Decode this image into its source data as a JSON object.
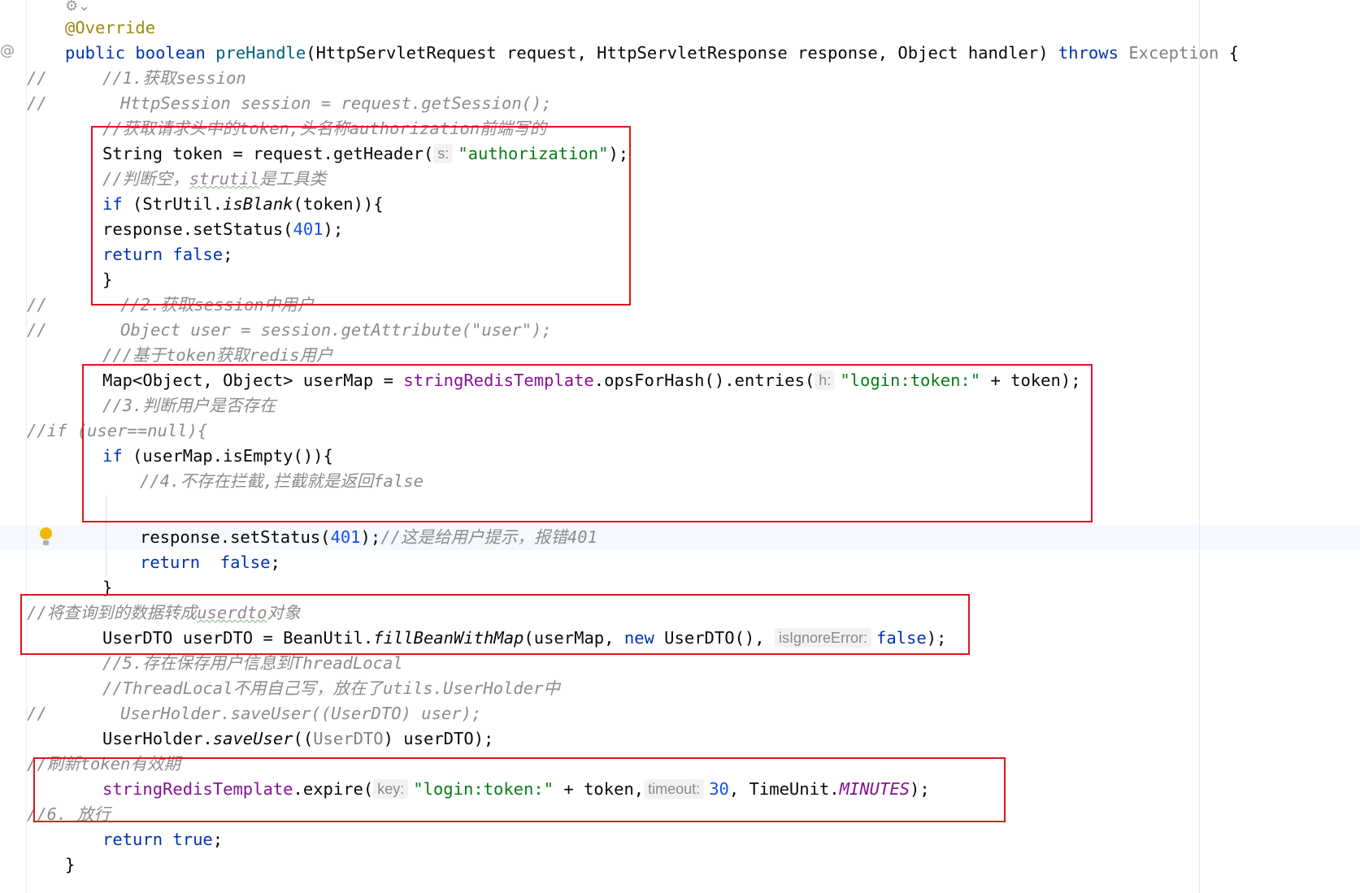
{
  "lines": {
    "l1": "@Override",
    "l2": {
      "kw1": "public",
      "kw2": "boolean",
      "method": "preHandle",
      "params": "(HttpServletRequest request, HttpServletResponse response, Object handler)",
      "throws": "throws",
      "exception": "Exception",
      "brace": " {"
    },
    "l3": {
      "slashes": "//",
      "text": "//1.获取session"
    },
    "l4": {
      "slashes": "//",
      "text": "HttpSession session = request.getSession();"
    },
    "l5": {
      "c1": "//获取请求头中的token,头名称authorization前端写的"
    },
    "l6": {
      "a": "String token = request.getHeader(",
      "hint": "s:",
      "str": "\"authorization\"",
      "b": ");"
    },
    "l7": {
      "a": "//判断空，",
      "typo": "strutil",
      "b": "是工具类"
    },
    "l8": {
      "kw": "if",
      "a": " (StrUtil.",
      "m": "isBlank",
      "b": "(token)){"
    },
    "l9": {
      "a": "response.setStatus(",
      "num": "401",
      "b": ");"
    },
    "l10": {
      "kw": "return",
      "kw2": "false",
      "b": ";"
    },
    "l11": "}",
    "l12": {
      "slashes": "//",
      "text": "//2.获取session中用户"
    },
    "l13": {
      "slashes": "//",
      "text": "Object user = session.getAttribute(\"user\");"
    },
    "l14": "///基于token获取redis用户",
    "l15": {
      "a": "Map<Object, Object> userMap = ",
      "fld": "stringRedisTemplate",
      "b": ".opsForHash().entries(",
      "hint": "h:",
      "str": "\"login:token:\"",
      "c": " + token);"
    },
    "l16": "//3.判断用户是否存在",
    "l17": "//if (user==null){",
    "l18": {
      "kw": "if",
      "a": " (userMap.isEmpty()){"
    },
    "l19": "//4.不存在拦截,拦截就是返回false",
    "l20": {
      "a": "response.setStatus(",
      "num": "401",
      "b": ");",
      "cm": "//这是给用户提示，报错401"
    },
    "l21": {
      "kw": "return",
      "kw2": "false",
      "b": ";"
    },
    "l22": "}",
    "l23": {
      "a": "//将查询到的数据转成",
      "typo": "userdto",
      "b": "对象"
    },
    "l24": {
      "a": "UserDTO userDTO = BeanUtil.",
      "m": "fillBeanWithMap",
      "b": "(userMap, ",
      "kw": "new",
      "c": " UserDTO(), ",
      "hint": "isIgnoreError:",
      "kw2": "false",
      "d": ");"
    },
    "l25": "//5.存在保存用户信息到ThreadLocal",
    "l26": "//ThreadLocal不用自己写，放在了utils.UserHolder中",
    "l27": {
      "slashes": "//",
      "text": "UserHolder.saveUser((UserDTO) user);"
    },
    "l28": {
      "a": "UserHolder.",
      "m": "saveUser",
      "b": "((",
      "dim": "UserDTO",
      "c": ") userDTO);"
    },
    "l29": "//刷新token有效期",
    "l30": {
      "fld": "stringRedisTemplate",
      "a": ".expire(",
      "hint1": "key:",
      "str": "\"login:token:\"",
      "b": " + token,",
      "hint2": "timeout:",
      "num": "30",
      "c": ", TimeUnit.",
      "const": "MINUTES",
      "d": ");"
    },
    "l31": "//6. 放行",
    "l32": {
      "kw": "return",
      "kw2": "true",
      "b": ";"
    },
    "l33": "}"
  },
  "colors": {
    "keyword": "#0033b3",
    "comment": "#8c8c8c",
    "string": "#067d17",
    "number": "#1750eb",
    "annotation": "#9e880d",
    "method": "#00627a",
    "field": "#871094",
    "highlight_box": "#e2141e"
  },
  "icons": [
    "gutter-fold-icon",
    "override-marker-icon",
    "lightbulb-icon"
  ]
}
